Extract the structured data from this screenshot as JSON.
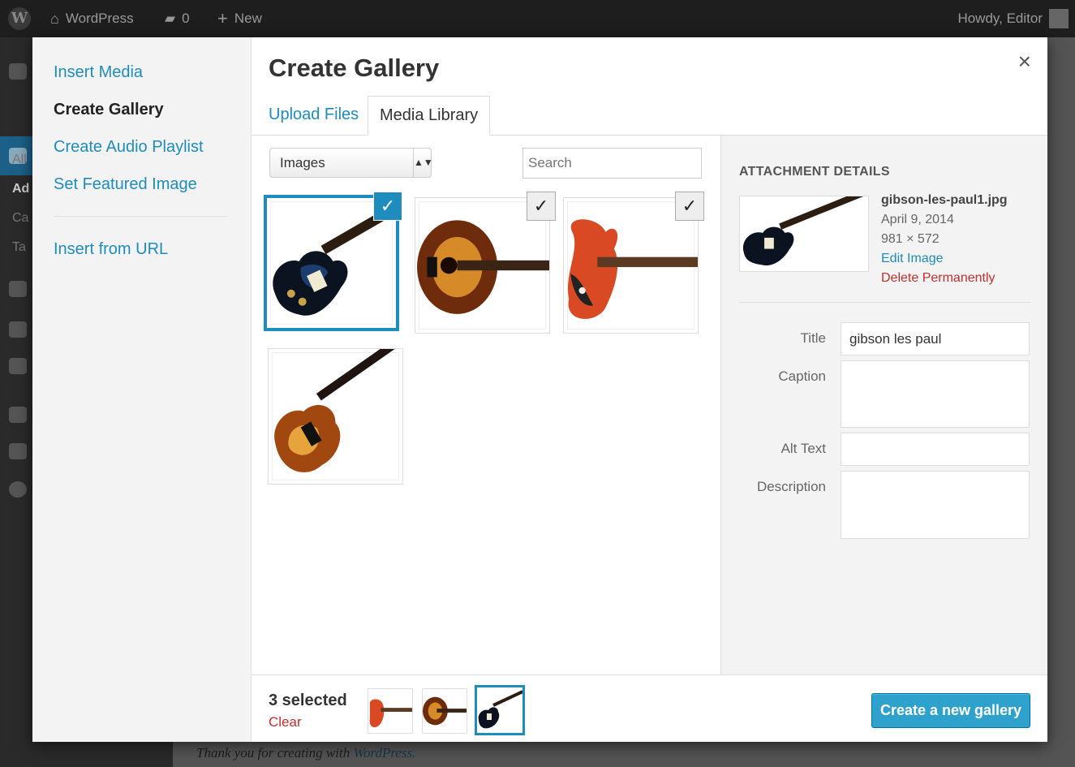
{
  "admin_bar": {
    "site_name": "WordPress",
    "comments_count": "0",
    "new_label": "New",
    "howdy": "Howdy, Editor"
  },
  "admin_sidebar_fragments": [
    "All",
    "Ad",
    "Ca",
    "Ta"
  ],
  "footer": {
    "text": "Thank you for creating with",
    "link": "WordPress."
  },
  "modal": {
    "menu": {
      "items": [
        {
          "label": "Insert Media",
          "active": false
        },
        {
          "label": "Create Gallery",
          "active": true
        },
        {
          "label": "Create Audio Playlist",
          "active": false
        },
        {
          "label": "Set Featured Image",
          "active": false
        }
      ],
      "insert_url": "Insert from URL"
    },
    "title": "Create Gallery",
    "close_glyph": "×",
    "tabs": [
      {
        "label": "Upload Files",
        "active": false
      },
      {
        "label": "Media Library",
        "active": true
      }
    ],
    "filter": {
      "value": "Images",
      "arrow": "▲▼"
    },
    "search": {
      "placeholder": "Search"
    },
    "attachments": [
      {
        "name": "les-paul-black",
        "selected": true,
        "checked": true,
        "check_glyph": "✓"
      },
      {
        "name": "acoustic-sunburst",
        "selected": false,
        "checked": true,
        "check_glyph": "✓"
      },
      {
        "name": "hollow-body-red",
        "selected": false,
        "checked": true,
        "check_glyph": "✓"
      },
      {
        "name": "solid-sunburst",
        "selected": false,
        "checked": false,
        "check_glyph": ""
      }
    ],
    "details": {
      "heading": "ATTACHMENT DETAILS",
      "filename": "gibson-les-paul1.jpg",
      "date": "April 9, 2014",
      "dimensions": "981 × 572",
      "edit_link": "Edit Image",
      "delete_link": "Delete Permanently",
      "fields": {
        "title_label": "Title",
        "title_value": "gibson les paul",
        "caption_label": "Caption",
        "caption_value": "",
        "alt_label": "Alt Text",
        "alt_value": "",
        "description_label": "Description",
        "description_value": ""
      }
    },
    "toolbar": {
      "selected_count": "3 selected",
      "clear_label": "Clear",
      "primary_button": "Create a new gallery"
    }
  },
  "colors": {
    "accent": "#1e8cbe",
    "danger": "#c62d2d",
    "button": "#2ea2cc"
  }
}
